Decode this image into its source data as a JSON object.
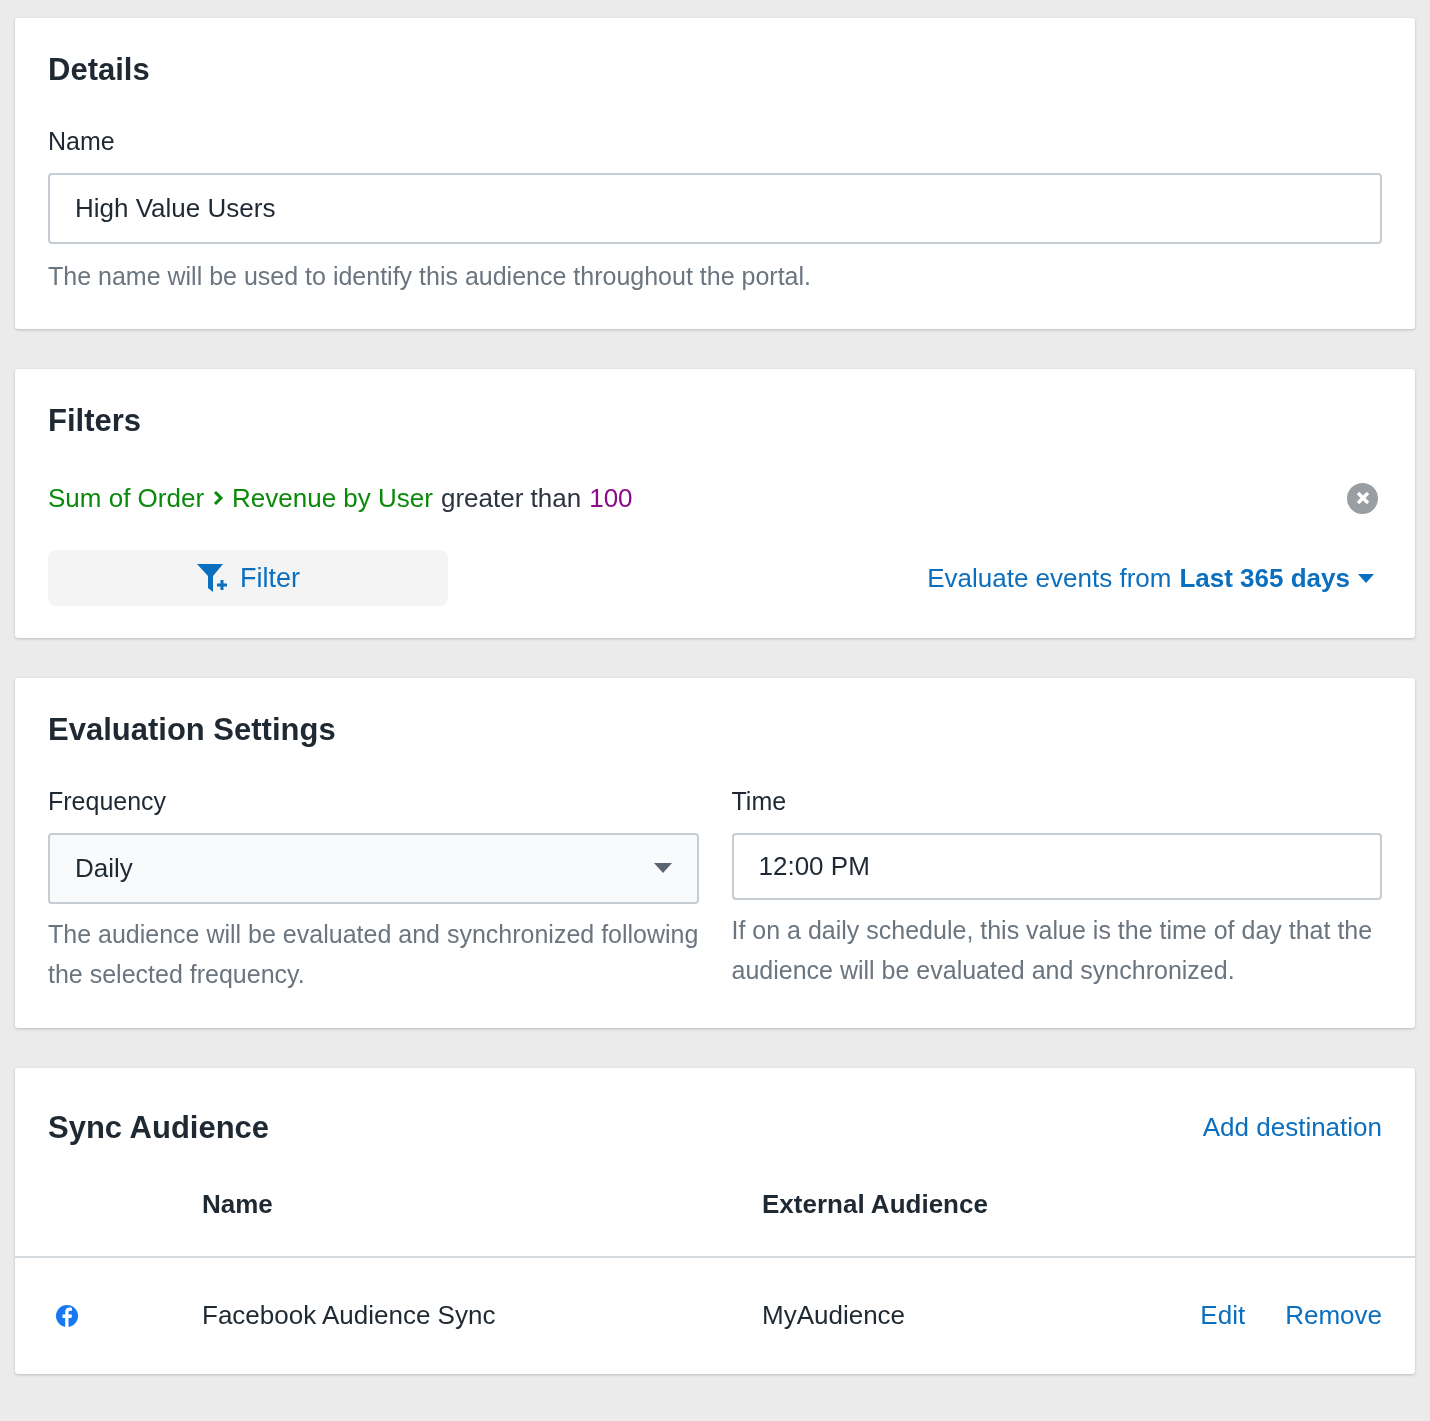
{
  "details": {
    "title": "Details",
    "name_field": {
      "label": "Name",
      "value": "High Value Users",
      "help": "The name will be used to identify this audience throughout the portal."
    }
  },
  "filters": {
    "title": "Filters",
    "conditions": [
      {
        "field_path": [
          "Sum of Order",
          "Revenue by User"
        ],
        "operator": "greater than",
        "value": "100"
      }
    ],
    "add_button": "Filter",
    "range": {
      "label": "Evaluate events from",
      "value": "Last 365 days"
    }
  },
  "evaluation_settings": {
    "title": "Evaluation Settings",
    "frequency": {
      "label": "Frequency",
      "value": "Daily",
      "help": "The audience will be evaluated and synchronized following the selected frequency."
    },
    "time": {
      "label": "Time",
      "value": "12:00 PM",
      "help": "If on a daily schedule, this value is the time of day that the audience will be evaluated and synchronized."
    }
  },
  "sync_audience": {
    "title": "Sync Audience",
    "add_link": "Add destination",
    "columns": [
      "Name",
      "External Audience"
    ],
    "rows": [
      {
        "name": "Facebook Audience Sync",
        "external_audience": "MyAudience",
        "actions": [
          "Edit",
          "Remove"
        ]
      }
    ]
  }
}
